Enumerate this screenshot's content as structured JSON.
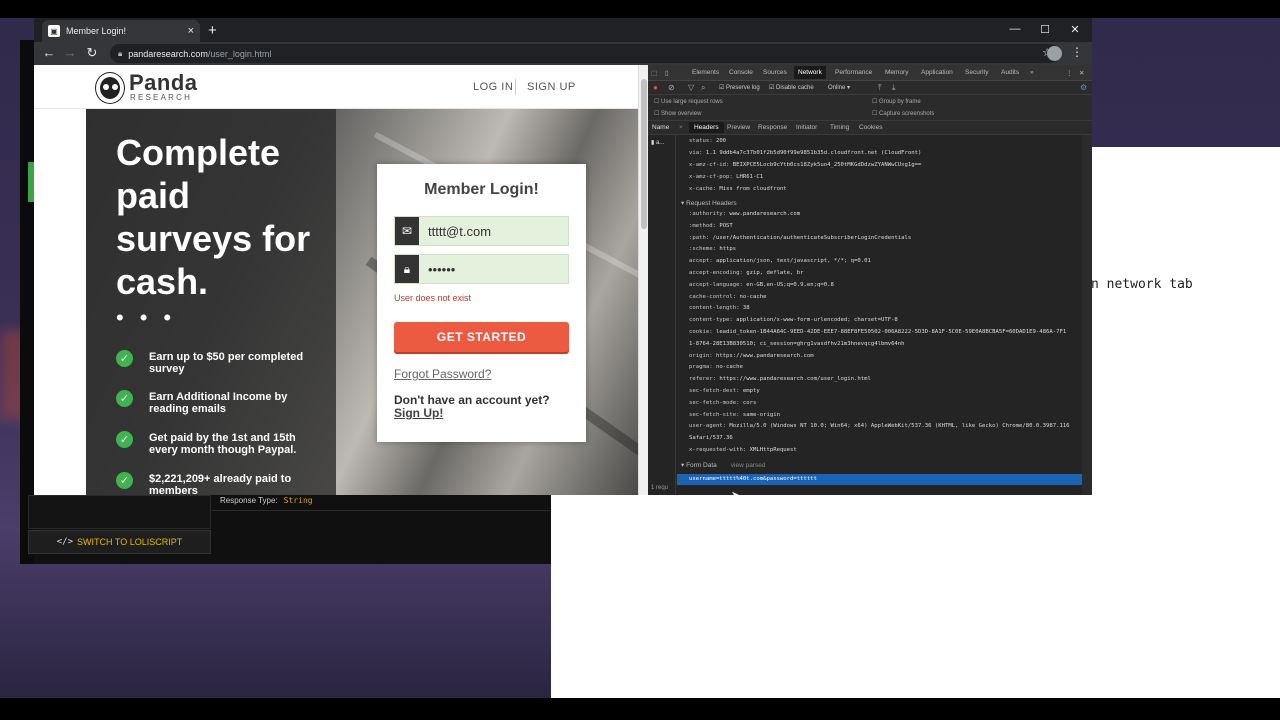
{
  "browser": {
    "tab_title": "Member Login!",
    "url_host": "pandaresearch.com",
    "url_path": "/user_login.html"
  },
  "site": {
    "logo_name": "Panda",
    "logo_sub": "RESEARCH",
    "nav_login": "LOG IN",
    "nav_signup": "SIGN UP",
    "hero_title": "Complete paid surveys for cash.",
    "benefits": [
      "Earn up to $50 per completed survey",
      "Earn Additional Income by reading emails",
      "Get paid by the 1st and 15th every month though Paypal.",
      "$2,221,209+ already paid to members"
    ],
    "login": {
      "title": "Member Login!",
      "email_value": "ttttt@t.com",
      "password_value": "••••••",
      "error": "User does not exist",
      "cta": "GET STARTED",
      "forgot": "Forgot Password?",
      "no_account": "Don't have an account yet?",
      "signup": "Sign Up!"
    }
  },
  "devtools": {
    "tabs": [
      "Elements",
      "Console",
      "Sources",
      "Network",
      "Performance",
      "Memory",
      "Application",
      "Security",
      "Audits",
      "»"
    ],
    "active_tab": "Network",
    "toolbar": {
      "preserve_log": "Preserve log",
      "disable_cache": "Disable cache",
      "throttle": "Online"
    },
    "options": {
      "large_rows": "Use large request rows",
      "group_frame": "Group by frame",
      "show_overview": "Show overview",
      "capture": "Capture screenshots"
    },
    "subtabs": [
      "Headers",
      "Preview",
      "Response",
      "Initiator",
      "Timing",
      "Cookies"
    ],
    "name_col": "Name",
    "name_row": "a...",
    "request_count": "1 requ",
    "response_headers": [
      [
        "status:",
        "200"
      ],
      [
        "via:",
        "1.1 9ddb4a7c37b01f2b5d90f99e9851b35d.cloudfront.net (CloudFront)"
      ],
      [
        "x-amz-cf-id:",
        "BEIXPCE5Locb9cYtb0cs18Zyk5uo4_250tMKGdDdzwZYANWwCUxg1g=="
      ],
      [
        "x-amz-cf-pop:",
        "LHR61-C1"
      ],
      [
        "x-cache:",
        "Miss from cloudfront"
      ]
    ],
    "request_headers_title": "Request Headers",
    "request_headers": [
      [
        ":authority:",
        "www.pandaresearch.com"
      ],
      [
        ":method:",
        "POST"
      ],
      [
        ":path:",
        "/user/Authentication/authenticateSubscriberLoginCredentials"
      ],
      [
        ":scheme:",
        "https"
      ],
      [
        "accept:",
        "application/json, text/javascript, */*; q=0.01"
      ],
      [
        "accept-encoding:",
        "gzip, deflate, br"
      ],
      [
        "accept-language:",
        "en-GB,en-US;q=0.9,en;q=0.8"
      ],
      [
        "cache-control:",
        "no-cache"
      ],
      [
        "content-length:",
        "38"
      ],
      [
        "content-type:",
        "application/x-www-form-urlencoded; charset=UTF-8"
      ],
      [
        "cookie:",
        "leadid_token-1B44A64C-9EED-42DE-EEE7-88EF8FE50502-006A8222-5D3D-8A1F-5C0E-59E0A8BCBA5F=60DAD1E9-486A-7F1"
      ],
      [
        "",
        "1-8764-28E13B830510; ci_session=ghrg1vasdfhv21m3hnevqcg4lbmv64nh"
      ],
      [
        "origin:",
        "https://www.pandaresearch.com"
      ],
      [
        "pragma:",
        "no-cache"
      ],
      [
        "referer:",
        "https://www.pandaresearch.com/user_login.html"
      ],
      [
        "sec-fetch-dest:",
        "empty"
      ],
      [
        "sec-fetch-mode:",
        "cors"
      ],
      [
        "sec-fetch-site:",
        "same-origin"
      ],
      [
        "user-agent:",
        "Mozilla/5.0 (Windows NT 10.0; Win64; x64) AppleWebKit/537.36 (KHTML, like Gecko) Chrome/80.0.3987.116"
      ],
      [
        "",
        "Safari/537.36"
      ],
      [
        "x-requested-with:",
        "XMLHttpRequest"
      ]
    ],
    "form_data_title": "Form Data",
    "form_data_link": "view parsed",
    "form_data_value": "username=ttttt%40t.com&password=tttttt"
  },
  "back_window": {
    "response_type_label": "Response Type:",
    "response_type_value": "String",
    "switch_button": "SWITCH TO LOLISCRIPT"
  },
  "right_window": {
    "partial_text": "n network tab"
  }
}
